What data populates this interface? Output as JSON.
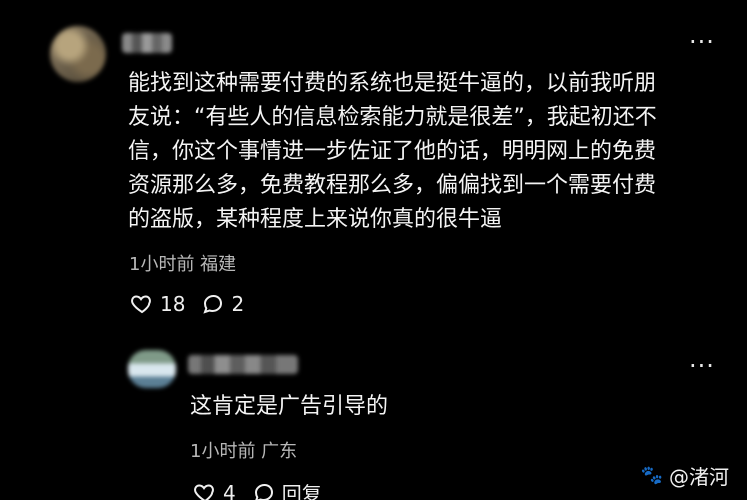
{
  "comment": {
    "text": "能找到这种需要付费的系统也是挺牛逼的，以前我听朋\n友说：“有些人的信息检索能力就是很差”，我起初还不\n信，你这个事情进一步佐证了他的话，明明网上的免费\n资源那么多，免费教程那么多，偏偏找到一个需要付费\n的盗版，某种程度上来说你真的很牛逼",
    "meta": "1小时前 福建",
    "likes": "18",
    "comments": "2",
    "more_label": "···"
  },
  "reply": {
    "text": "这肯定是广告引导的",
    "meta": "1小时前 广东",
    "likes": "4",
    "reply_label": "回复",
    "more_label": "···"
  },
  "watermark": {
    "text": "@渚河"
  },
  "icons": {
    "like": "heart-outline-icon",
    "comment": "speech-bubble-icon",
    "more": "more-dots-icon",
    "watermark": "paw-icon"
  }
}
